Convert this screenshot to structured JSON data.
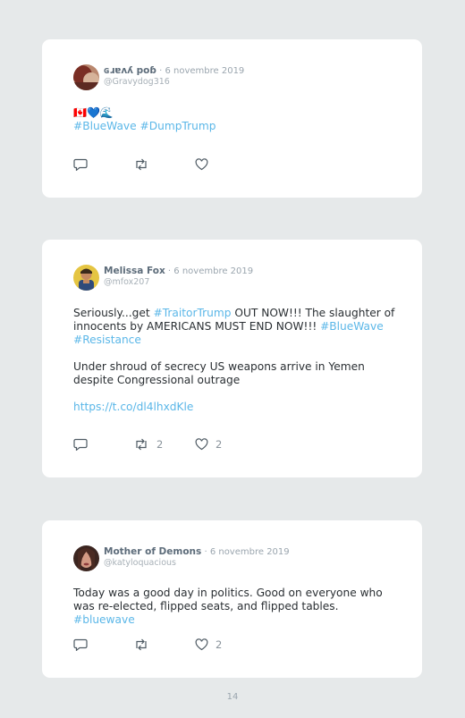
{
  "page_number": "14",
  "tweets": [
    {
      "display_name": "ɢɹɐʌʎ poɓ",
      "date_sep": " · ",
      "date": "6 novembre 2019",
      "handle": "@Gravydog316",
      "emoji": "🇨🇦💙🌊",
      "text_tags": "#BlueWave #DumpTrump",
      "retweets": "",
      "likes": ""
    },
    {
      "display_name": "Melissa Fox",
      "date_sep": " · ",
      "date": "6 novembre 2019",
      "handle": "@mfox207",
      "p1_a": "Seriously...get ",
      "p1_tag1": "#TraitorTrump",
      "p1_b": " OUT NOW!!! The slaughter of innocents by AMERICANS MUST END NOW!!! ",
      "p1_tag2": "#BlueWave",
      "p1_tag3": "#Resistance",
      "p2": "Under shroud of secrecy US weapons arrive in Yemen despite Congressional outrage",
      "link": "https://t.co/dl4lhxdKle",
      "retweets": "2",
      "likes": "2"
    },
    {
      "display_name": "Mother of Demons",
      "date_sep": " · ",
      "date": "6 novembre 2019",
      "handle": "@katyloquacious",
      "text": "Today was a good day in politics. Good on everyone who was re-elected, flipped seats, and flipped tables. ",
      "tag": "#bluewave",
      "retweets": "",
      "likes": "2"
    }
  ],
  "icons": [
    "reply-icon",
    "retweet-icon",
    "like-icon"
  ],
  "colors": {
    "hashtag": "#5bb7e8",
    "name": "#5d6c7a",
    "background": "#e6e9ea"
  }
}
